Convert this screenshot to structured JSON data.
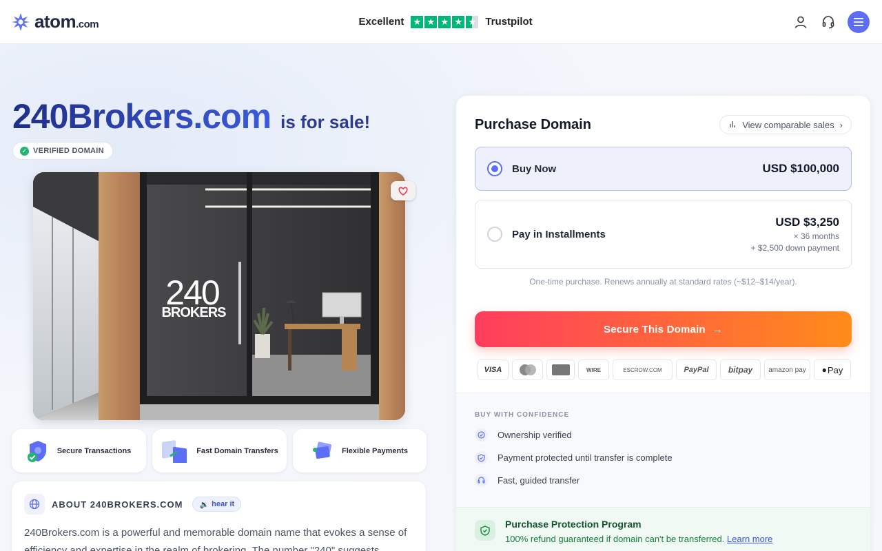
{
  "header": {
    "logo_text": "atom",
    "logo_suffix": ".com",
    "rating_label": "Excellent",
    "rating_brand": "Trustpilot",
    "rating_stars": 4.5
  },
  "hero": {
    "domain": "240Brokers.com",
    "for_sale": "is for sale!",
    "verified_badge": "VERIFIED DOMAIN",
    "logo_number": "240",
    "logo_word": "BROKERS"
  },
  "features": [
    {
      "label": "Secure Transactions",
      "icon": "shield-icon"
    },
    {
      "label": "Fast Domain Transfers",
      "icon": "transfer-icon"
    },
    {
      "label": "Flexible Payments",
      "icon": "card-icon"
    }
  ],
  "about": {
    "title": "ABOUT 240BROKERS.COM",
    "hear_label": "hear it",
    "text": "240Brokers.com is a powerful and memorable domain name that evokes a sense of efficiency and expertise in the realm of brokering. The number \"240\" suggests"
  },
  "purchase": {
    "title": "Purchase Domain",
    "comparable_label": "View comparable sales",
    "buy_now": {
      "label": "Buy Now",
      "price": "USD $100,000",
      "selected": true
    },
    "installments": {
      "label": "Pay in Installments",
      "price": "USD $3,250",
      "term": "× 36 months",
      "down": "+ $2,500 down payment"
    },
    "renewal_note": "One-time purchase. Renews annually at standard rates (~$12–$14/year).",
    "cta_label": "Secure This Domain",
    "payment_methods": [
      "VISA",
      "Mastercard",
      "Amex",
      "WIRE",
      "ESCROW.COM",
      "PayPal",
      "bitpay",
      "amazon pay",
      "Pay"
    ]
  },
  "confidence": {
    "title": "BUY WITH CONFIDENCE",
    "items": [
      "Ownership verified",
      "Payment protected until transfer is complete",
      "Fast, guided transfer"
    ]
  },
  "protection": {
    "title": "Purchase Protection Program",
    "text": "100% refund guaranteed if domain can't be transferred.",
    "link": "Learn more"
  },
  "colors": {
    "accent": "#5b6ef5",
    "cta_start": "#ff3d5e",
    "cta_end": "#ff8c1a",
    "trustpilot": "#00b67a"
  }
}
